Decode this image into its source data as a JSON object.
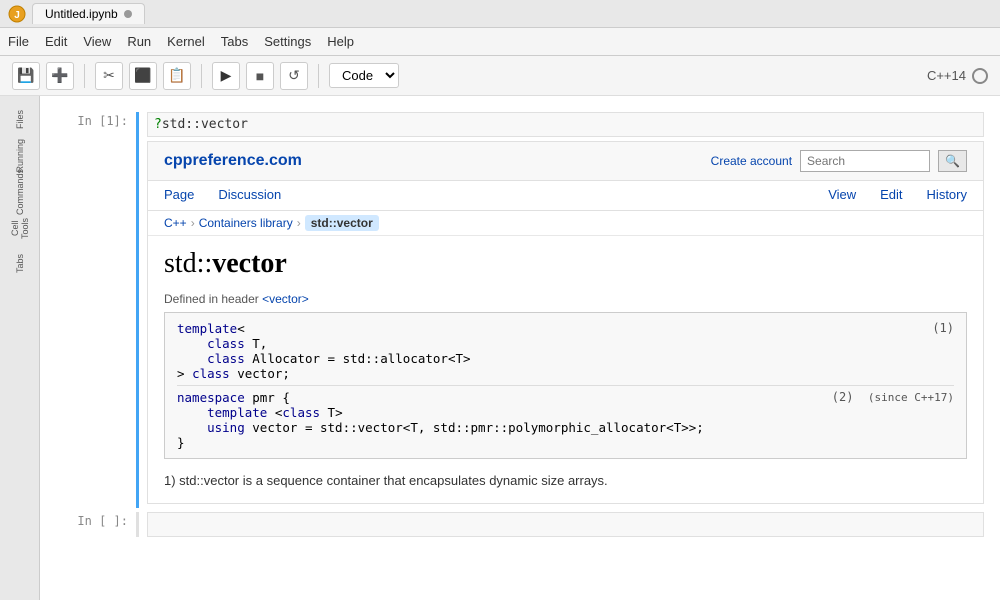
{
  "titlebar": {
    "tab_name": "Untitled.ipynb",
    "dot_color": "#aaa"
  },
  "menubar": {
    "items": [
      "File",
      "Edit",
      "View",
      "Run",
      "Kernel",
      "Tabs",
      "Settings",
      "Help"
    ]
  },
  "toolbar": {
    "save_tooltip": "Save",
    "add_tooltip": "Add cell",
    "cut_tooltip": "Cut",
    "copy_tooltip": "Copy",
    "paste_tooltip": "Paste",
    "run_tooltip": "Run",
    "stop_tooltip": "Stop",
    "restart_tooltip": "Restart",
    "cell_type": "Code",
    "kernel_name": "C++14"
  },
  "sidebar": {
    "items": [
      {
        "id": "files",
        "label": "Files"
      },
      {
        "id": "running",
        "label": "Running"
      },
      {
        "id": "commands",
        "label": "Commands"
      },
      {
        "id": "cell-tools",
        "label": "Cell Tools"
      },
      {
        "id": "tabs",
        "label": "Tabs"
      }
    ]
  },
  "cell1": {
    "prompt": "In [1]:",
    "input": "?std::vector"
  },
  "cell2": {
    "prompt": "In [ ]:",
    "input": ""
  },
  "cppref": {
    "logo": "cppreference.com",
    "create_account": "Create account",
    "search_placeholder": "Search",
    "nav_left": [
      {
        "id": "page",
        "label": "Page"
      },
      {
        "id": "discussion",
        "label": "Discussion"
      }
    ],
    "nav_right": [
      {
        "id": "view",
        "label": "View"
      },
      {
        "id": "edit",
        "label": "Edit"
      },
      {
        "id": "history",
        "label": "History"
      }
    ],
    "breadcrumb": [
      {
        "id": "cpp",
        "label": "C++"
      },
      {
        "id": "containers",
        "label": "Containers library"
      },
      {
        "id": "vector",
        "label": "std::vector",
        "current": true
      }
    ],
    "title": "std::vector",
    "defined_in": "Defined in header",
    "header_link": "<vector>",
    "code_block1_lines": [
      "template<",
      "    class T,",
      "    class Allocator = std::allocator<T>",
      "> class vector;"
    ],
    "code_block1_num": "(1)",
    "code_block2_lines": [
      "namespace pmr {",
      "    template <class T>",
      "    using vector = std::vector<T, std::pmr::polymorphic_allocator<T>>;",
      "}"
    ],
    "code_block2_num": "(2)",
    "code_block2_since": "since C++17",
    "description": "1) std::vector is a sequence container that encapsulates dynamic size arrays."
  }
}
